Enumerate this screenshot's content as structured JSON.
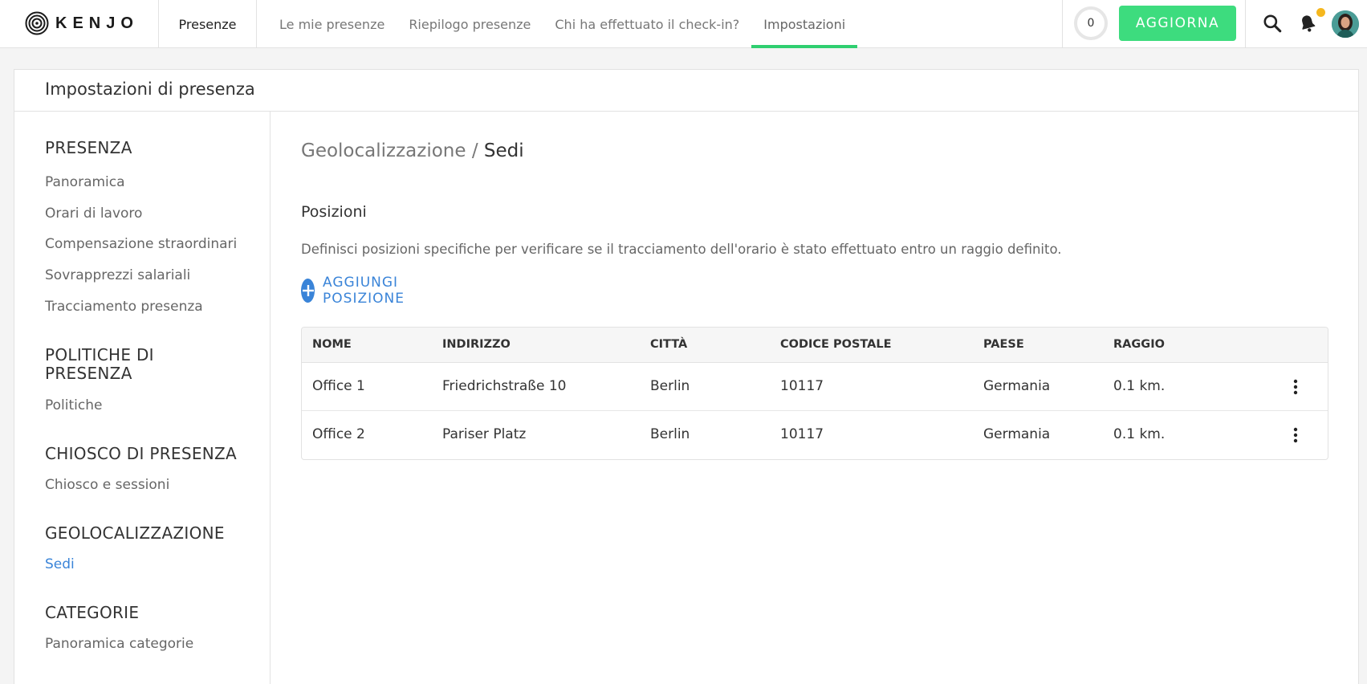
{
  "topbar": {
    "logo_text": "KENJO",
    "module": "Presenze",
    "tabs": [
      {
        "label": "Le mie presenze",
        "active": false
      },
      {
        "label": "Riepilogo presenze",
        "active": false
      },
      {
        "label": "Chi ha effettuato il check-in?",
        "active": false
      },
      {
        "label": "Impostazioni",
        "active": true
      }
    ],
    "counter": "0",
    "update_button": "AGGIORNA",
    "accent_color": "#3ddc7e",
    "notification_dot_color": "#f5b71e",
    "icons": [
      "search-icon",
      "bell-icon",
      "avatar"
    ]
  },
  "page": {
    "title": "Impostazioni di presenza"
  },
  "sidebar": {
    "sections": [
      {
        "title": "PRESENZA",
        "items": [
          "Panoramica",
          "Orari di lavoro",
          "Compensazione straordinari",
          "Sovrapprezzi salariali",
          "Tracciamento presenza"
        ]
      },
      {
        "title": "POLITICHE DI PRESENZA",
        "items": [
          "Politiche"
        ]
      },
      {
        "title": "CHIOSCO DI PRESENZA",
        "items": [
          "Chiosco e sessioni"
        ]
      },
      {
        "title": "GEOLOCALIZZAZIONE",
        "items": [
          "Sedi"
        ]
      },
      {
        "title": "CATEGORIE",
        "items": [
          "Panoramica categorie"
        ]
      }
    ],
    "active_item": "Sedi",
    "active_color": "#3a84d8"
  },
  "main": {
    "breadcrumb": {
      "parent": "Geolocalizzazione",
      "separator": " / ",
      "current": "Sedi"
    },
    "section_title": "Posizioni",
    "description": "Definisci posizioni specifiche per verificare se il tracciamento dell'orario è stato effettuato entro un raggio definito.",
    "add_button": "AGGIUNGI POSIZIONE",
    "table": {
      "columns": [
        "NOME",
        "INDIRIZZO",
        "CITTÀ",
        "CODICE POSTALE",
        "PAESE",
        "RAGGIO"
      ],
      "rows": [
        [
          "Office 1",
          "Friedrichstraße 10",
          "Berlin",
          "10117",
          "Germania",
          "0.1 km."
        ],
        [
          "Office 2",
          "Pariser Platz",
          "Berlin",
          "10117",
          "Germania",
          "0.1 km."
        ]
      ]
    }
  }
}
